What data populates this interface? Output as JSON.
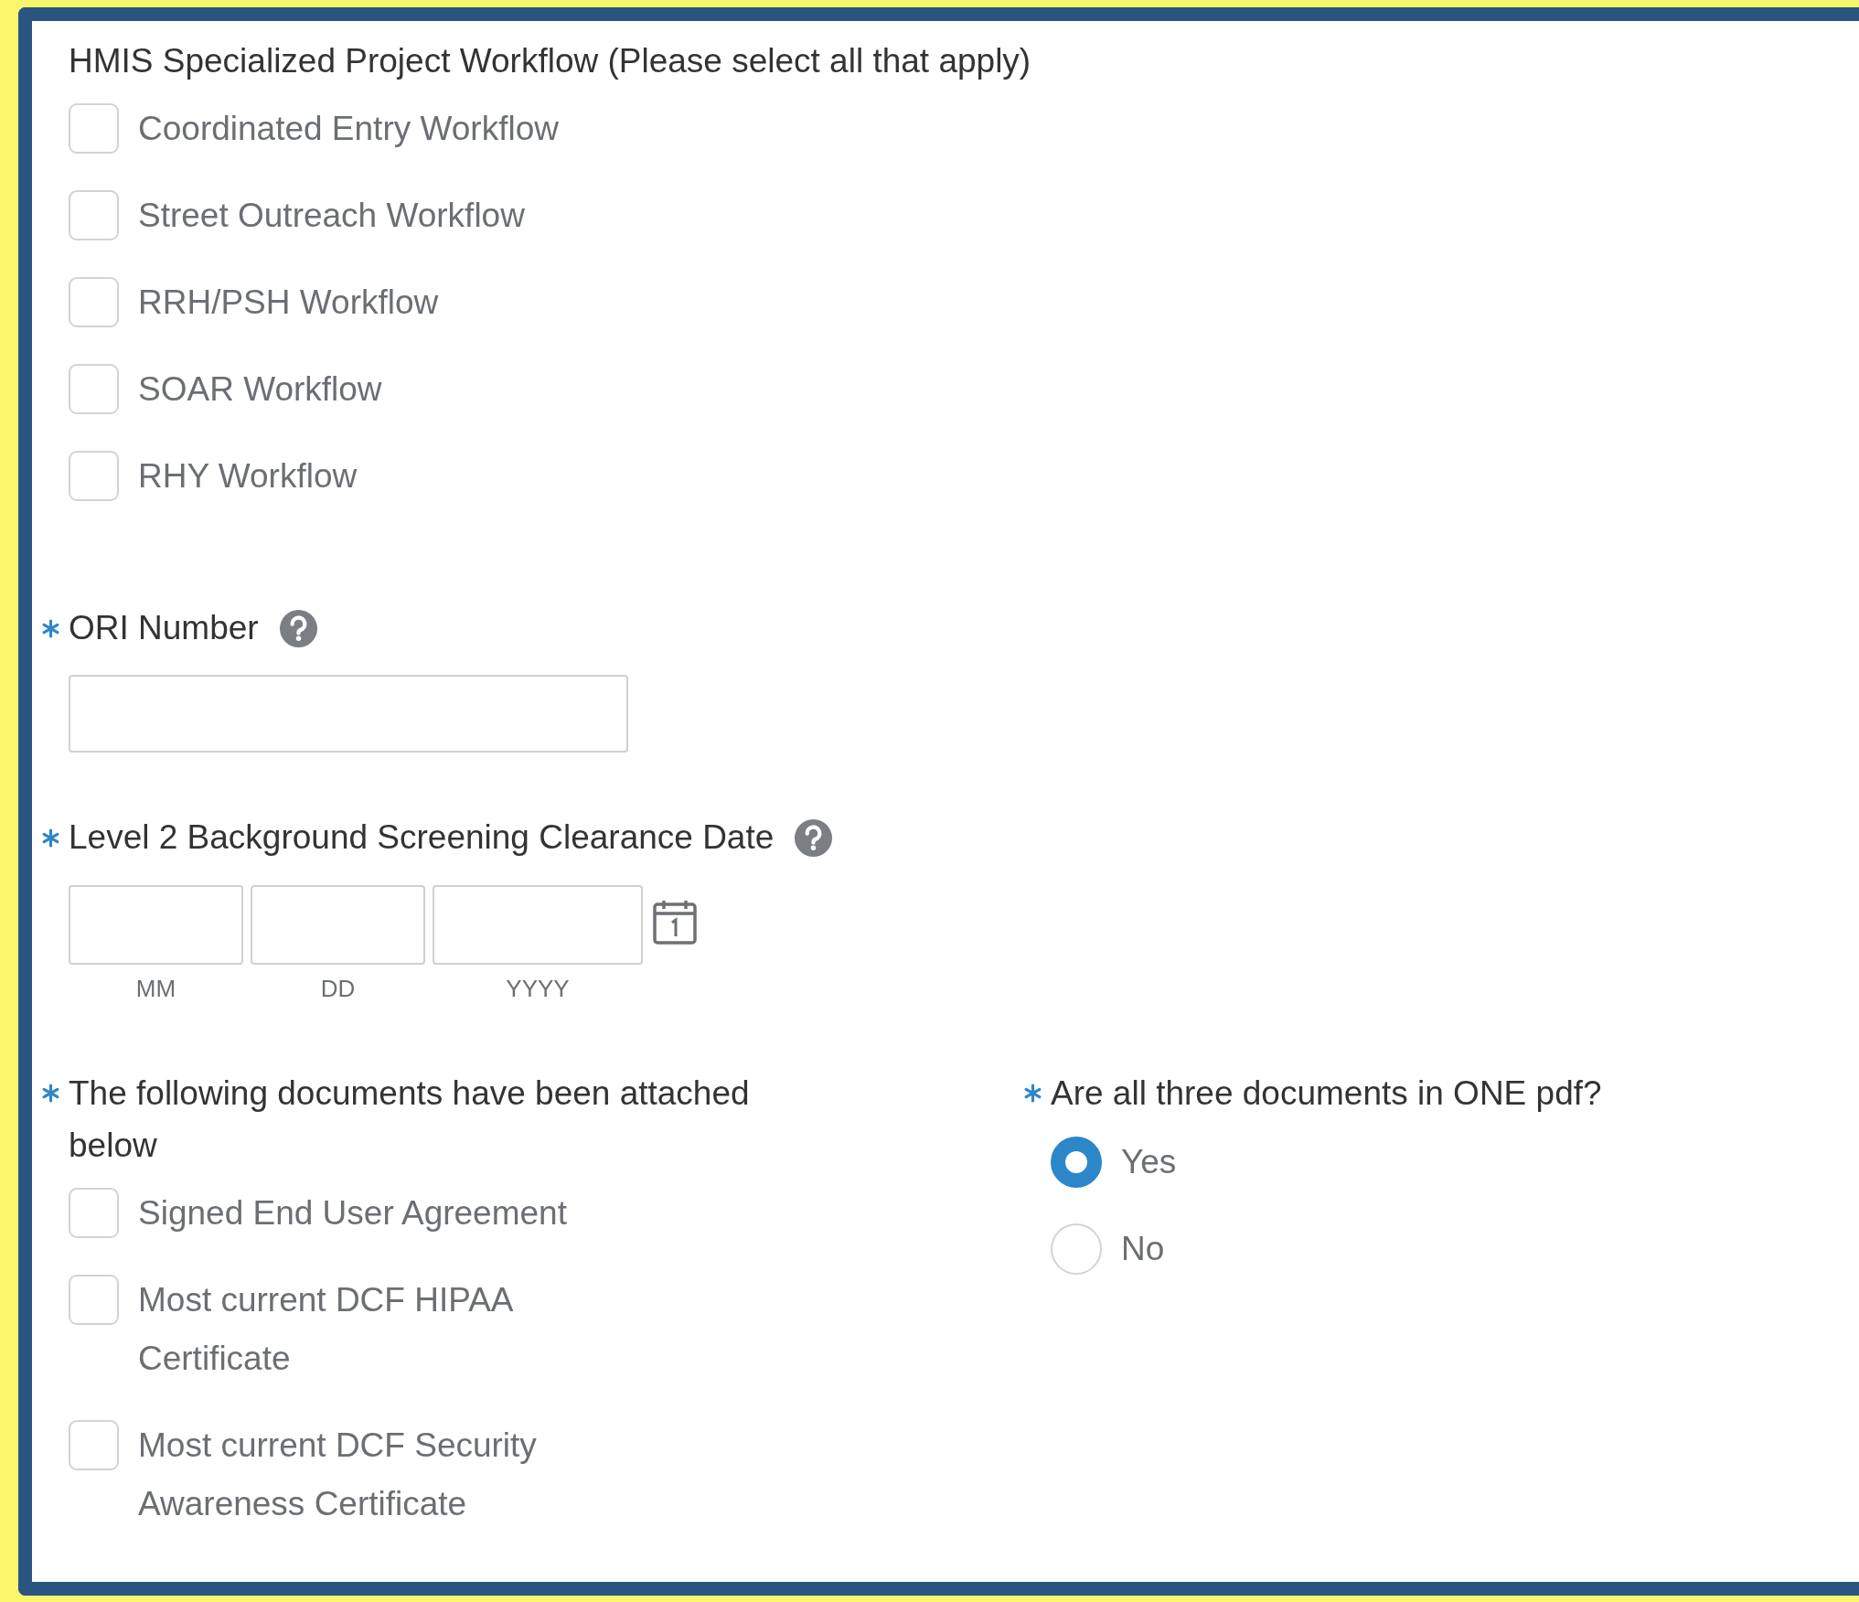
{
  "workflow": {
    "label": "HMIS Specialized Project Workflow (Please select all that apply)",
    "options": [
      {
        "label": "Coordinated Entry Workflow",
        "checked": false
      },
      {
        "label": "Street Outreach Workflow",
        "checked": false
      },
      {
        "label": "RRH/PSH Workflow",
        "checked": false
      },
      {
        "label": "SOAR Workflow",
        "checked": false
      },
      {
        "label": "RHY Workflow",
        "checked": false
      }
    ]
  },
  "ori": {
    "label": "ORI Number",
    "required": true
  },
  "clearance_date": {
    "label": "Level 2 Background Screening Clearance Date",
    "required": true,
    "parts": [
      {
        "caption": "MM"
      },
      {
        "caption": "DD"
      },
      {
        "caption": "YYYY"
      }
    ]
  },
  "documents": {
    "label": "The following documents have been attached below",
    "required": true,
    "options": [
      {
        "label": "Signed End User Agreement",
        "checked": false
      },
      {
        "label": "Most current DCF HIPAA Certificate",
        "checked": false
      },
      {
        "label": "Most current DCF Security Awareness Certificate",
        "checked": false
      }
    ]
  },
  "one_pdf": {
    "label": "Are all three documents in ONE pdf?",
    "required": true,
    "options": [
      {
        "label": "Yes",
        "selected": true
      },
      {
        "label": "No",
        "selected": false
      }
    ]
  }
}
